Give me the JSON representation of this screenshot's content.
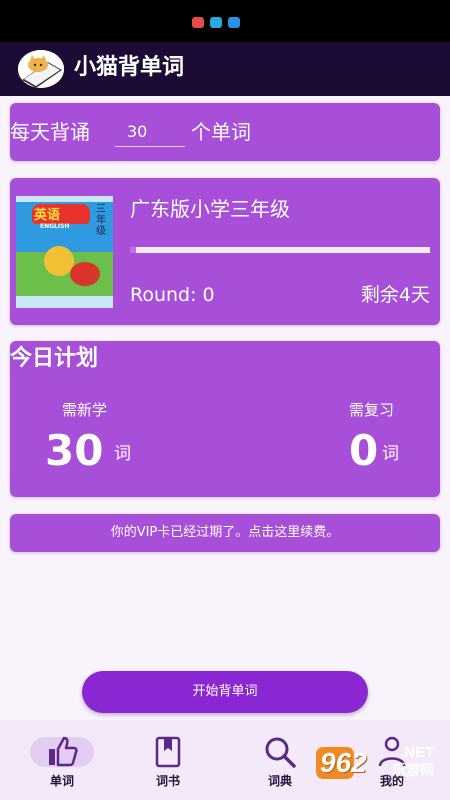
{
  "colors": {
    "status_bar": "#000000",
    "app_bar": "#1c0b34",
    "card": "#a74fd9",
    "progress_track": "#eeeeee",
    "progress_fill": "#c16ee8",
    "button": "#8a27d2",
    "page_background": "#f9f3fc",
    "bottom_nav": "#f3e9f8"
  },
  "status_bar": {
    "icons": [
      {
        "name": "notification-app-icon-1",
        "color": "#e94b4b"
      },
      {
        "name": "notification-app-icon-2",
        "color": "#29a9e0"
      },
      {
        "name": "notification-app-icon-3",
        "color": "#2b8fe8"
      }
    ]
  },
  "app_bar": {
    "title": "小猫背单词",
    "avatar_icon": "cat-logo-icon"
  },
  "daily_count": {
    "prefix": "每天背诵",
    "value": "30",
    "suffix": "个单词"
  },
  "book": {
    "name": "广东版小学三年级",
    "progress": 0.02,
    "round_text": "Round: 0",
    "remaining_text": "剩余4天",
    "cover": {
      "title": "英语",
      "subtitle": "ENGLISH",
      "grade": "三年级"
    }
  },
  "plan": {
    "title": "今日计划",
    "new_label": "需新学",
    "new_count": "30",
    "new_unit": "词",
    "review_label": "需复习",
    "review_count": "0",
    "review_unit": "词"
  },
  "vip": {
    "notice": "你的VIP卡已经过期了。点击这里续费。"
  },
  "start_button": {
    "label": "开始背单词"
  },
  "bottom_nav": {
    "items": [
      {
        "label": "单词",
        "icon": "thumbs-up-icon",
        "active": true
      },
      {
        "label": "词书",
        "icon": "bookmark-book-icon",
        "active": false
      },
      {
        "label": "词典",
        "icon": "search-icon",
        "active": false
      },
      {
        "label": "我的",
        "icon": "user-icon",
        "active": false
      }
    ]
  },
  "watermark": {
    "number": "962",
    "domain": ".NET",
    "site_name": "乐游网"
  }
}
